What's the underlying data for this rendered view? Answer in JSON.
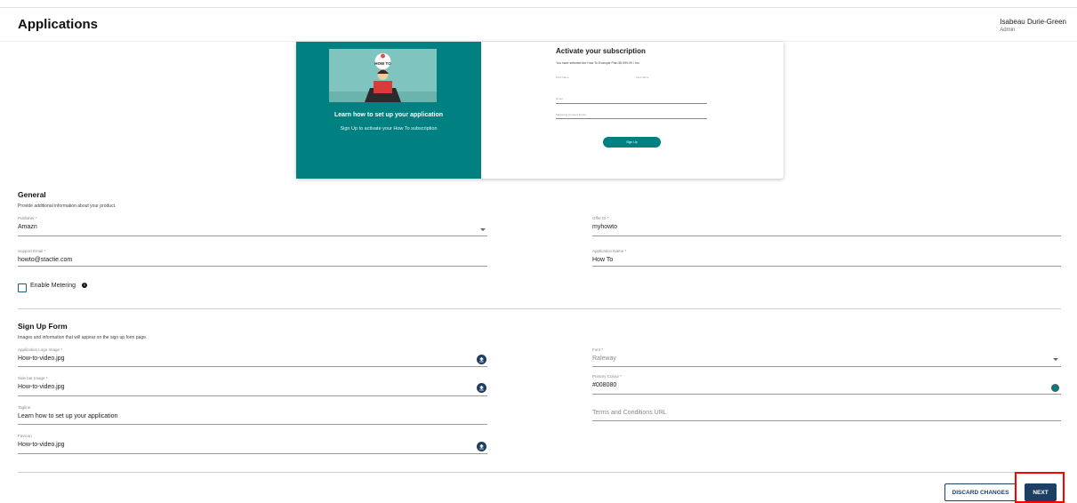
{
  "header": {
    "title": "Applications",
    "user_name": "Isabeau Durie-Green",
    "user_role": "Admin"
  },
  "preview": {
    "tagline": "Learn how to set up your application",
    "subline": "Sign Up to activate your How To subscription",
    "hero_badge": "HOW TO",
    "activate_title": "Activate your subscription",
    "activate_sub": "You have selected the How To Example Plan $9,999.99 / mo",
    "mini_fields": [
      "First Name",
      "Last Name",
      "Email",
      "Marketing Consent Email"
    ],
    "signup_label": "Sign Up"
  },
  "general": {
    "title": "General",
    "description": "Provide additional information about your product.",
    "publisher": {
      "label": "Publisher *",
      "value": "Amazn"
    },
    "offer_id": {
      "label": "Offer ID *",
      "value": "myhowto"
    },
    "support_email": {
      "label": "Support Email *",
      "value": "howto@stactie.com"
    },
    "application_name": {
      "label": "Application Name *",
      "value": "How To"
    },
    "enable_metering": "Enable Metering"
  },
  "signup_form": {
    "title": "Sign Up Form",
    "description": "Images and information that will appear on the sign up form page.",
    "logo_image": {
      "label": "Application Logo Image *",
      "value": "How-to-video.jpg"
    },
    "font": {
      "label": "Font *",
      "value": "Raleway"
    },
    "sidebar_image": {
      "label": "Side bar Image *",
      "value": "How-to-video.jpg"
    },
    "primary_colour": {
      "label": "Primary Colour *",
      "value": "#008080"
    },
    "tagline": {
      "label": "Tagline",
      "value": "Learn how to set up your application"
    },
    "terms_url": {
      "placeholder": "Terms and Conditions URL"
    },
    "favicon": {
      "label": "Favicon",
      "value": "How-to-video.jpg"
    }
  },
  "actions": {
    "discard_label": "DISCARD CHANGES",
    "next_label": "NEXT"
  },
  "colors": {
    "accent": "#008080",
    "navy": "#1d3f64",
    "highlight": "#ff0000"
  }
}
